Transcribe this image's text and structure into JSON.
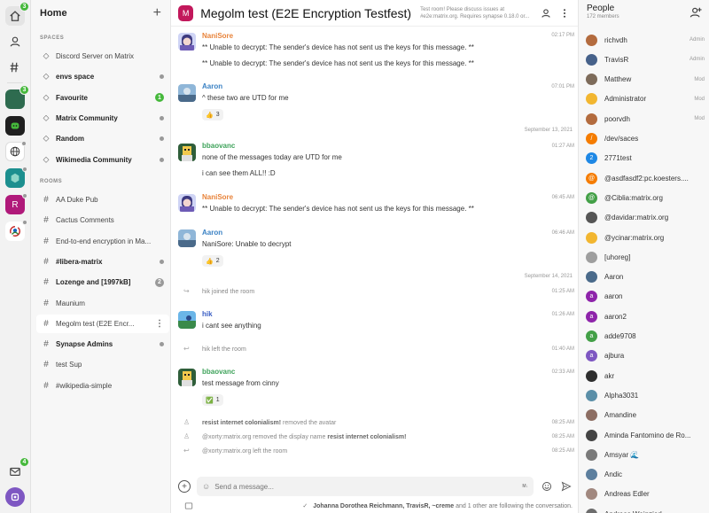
{
  "rail": {
    "home_badge": "3",
    "space1_badge": "3",
    "dm_badge": "4"
  },
  "sidebar": {
    "title": "Home",
    "spaces_label": "SPACES",
    "rooms_label": "ROOMS",
    "spaces": [
      {
        "label": "Discord Server on Matrix",
        "bold": false,
        "indicator": ""
      },
      {
        "label": "envs space",
        "bold": true,
        "indicator": "dot"
      },
      {
        "label": "Favourite",
        "bold": true,
        "indicator": "1"
      },
      {
        "label": "Matrix Community",
        "bold": true,
        "indicator": "dot"
      },
      {
        "label": "Random",
        "bold": true,
        "indicator": "dot"
      },
      {
        "label": "Wikimedia Community",
        "bold": true,
        "indicator": "dot"
      }
    ],
    "rooms": [
      {
        "label": "AA Duke Pub",
        "bold": false,
        "indicator": ""
      },
      {
        "label": "Cactus Comments",
        "bold": false,
        "indicator": ""
      },
      {
        "label": "End-to-end encryption in Ma...",
        "bold": false,
        "indicator": ""
      },
      {
        "label": "#libera-matrix",
        "bold": true,
        "indicator": "dot"
      },
      {
        "label": "Lozenge and [1997kB]",
        "bold": true,
        "indicator": "2"
      },
      {
        "label": "Maunium",
        "bold": false,
        "indicator": ""
      },
      {
        "label": "Megolm test (E2E Encr...",
        "bold": false,
        "indicator": "kebab"
      },
      {
        "label": "Synapse Admins",
        "bold": true,
        "indicator": "dot"
      },
      {
        "label": "test Sup",
        "bold": false,
        "indicator": ""
      },
      {
        "label": "#wikipedia-simple",
        "bold": false,
        "indicator": ""
      }
    ]
  },
  "header": {
    "avatar_letter": "M",
    "title": "Megolm test (E2E Encryption Testfest)",
    "topic": "Test room! Please discuss issues at #e2e:matrix.org. Requires synapse 0.18.0 or..."
  },
  "timeline": {
    "undecryptable": "** Unable to decrypt: The sender's device has not sent us the keys for this message. **",
    "messages": [
      {
        "sender": "NaniSore",
        "time": "02:17 PM",
        "lines": [
          "** Unable to decrypt: The sender's device has not sent us the keys for this message. **",
          "** Unable to decrypt: The sender's device has not sent us the keys for this message. **"
        ]
      },
      {
        "sender": "Aaron",
        "time": "07:01 PM",
        "lines": [
          "^ these two are UTD for me"
        ],
        "reaction": "👍",
        "reaction_count": "3"
      },
      {
        "date": "September 13, 2021"
      },
      {
        "sender": "bbaovanc",
        "time": "01:27 AM",
        "lines": [
          "none of the messages today are UTD for me",
          "i can see them ALL!! :D"
        ]
      },
      {
        "sender": "NaniSore",
        "time": "06:45 AM",
        "lines": [
          "** Unable to decrypt: The sender's device has not sent us the keys for this message. **"
        ]
      },
      {
        "sender": "Aaron",
        "time": "06:46 AM",
        "lines": [
          "NaniSore: Unable to decrypt"
        ],
        "reaction": "👍",
        "reaction_count": "2"
      },
      {
        "date": "September 14, 2021"
      },
      {
        "state": "hik joined the room",
        "time": "01:25 AM"
      },
      {
        "sender": "hik",
        "time": "01:26 AM",
        "lines": [
          "i cant see anything"
        ]
      },
      {
        "state": "hik left the room",
        "time": "01:40 AM"
      },
      {
        "sender": "bbaovanc",
        "time": "02:33 AM",
        "lines": [
          "test message from cinny"
        ],
        "reaction": "✅",
        "reaction_count": "1"
      }
    ],
    "states": [
      {
        "actor": "resist internet colonialism!",
        "text": "removed the avatar",
        "time": "08:25 AM"
      },
      {
        "actor": "@xorty:matrix.org",
        "text": "removed the display name",
        "target": "resist internet colonialism!",
        "time": "08:25 AM"
      },
      {
        "actor": "@xorty:matrix.org",
        "text": "left the room",
        "time": "08:25 AM"
      }
    ]
  },
  "composer": {
    "placeholder": "Send a message...",
    "markdown_badge": "M↓"
  },
  "following": {
    "names": "Johanna Dorothea Reichmann, TravisR, ~creme",
    "suffix": "and 1 other are following the conversation."
  },
  "people": {
    "title": "People",
    "count": "172 members",
    "members": [
      {
        "name": "richvdh",
        "role": "Admin",
        "color": "#b36b3e",
        "letter": ""
      },
      {
        "name": "TravisR",
        "role": "Admin",
        "color": "#46618a",
        "letter": ""
      },
      {
        "name": "Matthew",
        "role": "Mod",
        "color": "#7d6b5a",
        "letter": ""
      },
      {
        "name": "Administrator",
        "role": "Mod",
        "color": "#f2b630",
        "letter": ""
      },
      {
        "name": "poorvdh",
        "role": "Mod",
        "color": "#b36b3e",
        "letter": ""
      },
      {
        "name": "/dev/saces",
        "role": "",
        "color": "#f57c00",
        "letter": "/"
      },
      {
        "name": "2771test",
        "role": "",
        "color": "#1e88e5",
        "letter": "2"
      },
      {
        "name": "@asdfasdf2:pc.koesters....",
        "role": "",
        "color": "#f57c00",
        "letter": "@"
      },
      {
        "name": "@Ciblia:matrix.org",
        "role": "",
        "color": "#43a047",
        "letter": "@"
      },
      {
        "name": "@davidar:matrix.org",
        "role": "",
        "color": "#555555",
        "letter": ""
      },
      {
        "name": "@ycinar:matrix.org",
        "role": "",
        "color": "#f2b630",
        "letter": ""
      },
      {
        "name": "[uhoreg]",
        "role": "",
        "color": "#9e9e9e",
        "letter": ""
      },
      {
        "name": "Aaron",
        "role": "",
        "color": "#4a6a8a",
        "letter": ""
      },
      {
        "name": "aaron",
        "role": "",
        "color": "#8e24aa",
        "letter": "a"
      },
      {
        "name": "aaron2",
        "role": "",
        "color": "#8e24aa",
        "letter": "a"
      },
      {
        "name": "adde9708",
        "role": "",
        "color": "#43a047",
        "letter": "a"
      },
      {
        "name": "ajbura",
        "role": "",
        "color": "#7e57c2",
        "letter": "a"
      },
      {
        "name": "akr",
        "role": "",
        "color": "#2e2e2e",
        "letter": ""
      },
      {
        "name": "Alpha3031",
        "role": "",
        "color": "#5b8fa8",
        "letter": ""
      },
      {
        "name": "Amandine",
        "role": "",
        "color": "#8d6e63",
        "letter": ""
      },
      {
        "name": "Aminda Fantomino de Ro...",
        "role": "",
        "color": "#444444",
        "letter": ""
      },
      {
        "name": "Amsyar 🌊",
        "role": "",
        "color": "#7a7a7a",
        "letter": ""
      },
      {
        "name": "Andic",
        "role": "",
        "color": "#5d7f9e",
        "letter": ""
      },
      {
        "name": "Andreas Edler",
        "role": "",
        "color": "#a1887f",
        "letter": ""
      },
      {
        "name": "Andreas Weinzierl",
        "role": "",
        "color": "#6d6d6d",
        "letter": ""
      }
    ]
  },
  "colors": {
    "accent": "#5c6bc0",
    "nanisore": "#e8833a",
    "aaron": "#3b82c4",
    "bbaovanc": "#3fa35b",
    "hik": "#3b5ec4"
  }
}
